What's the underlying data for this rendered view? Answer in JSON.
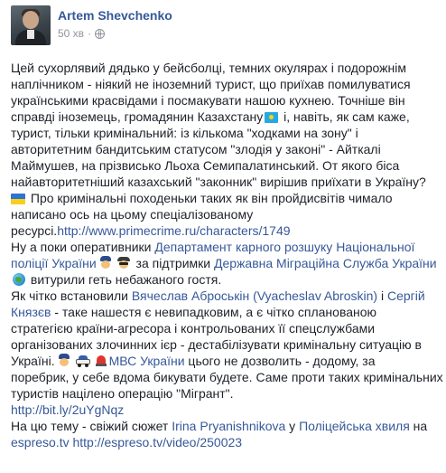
{
  "post": {
    "author": "Artem Shevchenko",
    "time": "50 хв",
    "globe_icon": "globe-icon",
    "lines": [
      {
        "text": "Цей сухорлявий дядько у бейсболці, темних окулярах і подорожнім"
      },
      {
        "text": "наплічником - ніякий не іноземний турист, що приїхав помилуватися"
      },
      {
        "text": "українськими красвідами і посмакувати нашою кухнею. Точніше він"
      },
      {
        "before": "справді іноземець, громадянин Казахстану",
        "emoji": "kazakhstan-flag-icon",
        "after": " і, навіть, як сам каже,"
      },
      {
        "text": "турист, тільки кримінальний: із кількома \"ходками на зону\" і"
      },
      {
        "text": "авторитетним бандитським статусом \"злодія у законі\" - Айткалі"
      },
      {
        "text": "Маймушев, на прізвисько Льоха Семипалатинський. От якого біса"
      },
      {
        "text": "найавторитетніший казахський \"законник\" вирішив приїхати в Україну?"
      },
      {
        "emoji": "ukraine-flag-icon",
        "after": " Про кримінальні походеньки таких як він пройдисвітів чимало"
      },
      {
        "text": "написано ось на цьому спеціалізованому"
      },
      {
        "before": "ресурсі.",
        "link": "http://www.primecrime.ru/characters/1749"
      }
    ],
    "p2": {
      "l1_before": "Ну а поки оперативники ",
      "l1_link": "Департамент карного розшуку Національної",
      "l2_link": "поліції України",
      "l2_mid": " за підтримки ",
      "l2_link2": "Державна Міграційна Служба України",
      "l3_after": " витурили геть небажаного гостя."
    },
    "p3": {
      "l1_before": "Як чітко встановили ",
      "l1_link": "Вячеслав Аброськін (Vyacheslav Abroskin)",
      "l1_mid": " і ",
      "l1_link2": "Сергій",
      "l2_link": "Князєв",
      "l2_after": " - таке нашестя є невипадковим, а є чітко спланованою",
      "l3": "стратегією країни-агресора і контрольованих її спецслужбами",
      "l4": "організованих злочинних ієр - дестабілізувати кримінальну ситуацію в",
      "l5_before": "Україні.",
      "l5_link": "МВС України",
      "l5_after": " цього не дозволить - додому, за",
      "l6": "поребрик, у себе вдома бикувати будете. Саме проти таких кримінальних",
      "l7": "туристів націлено операцію \"Мігрант\".",
      "l8_link": "http://bit.ly/2uYgNqz"
    },
    "p4": {
      "l1_before": "На цю тему - свіжий сюжет ",
      "l1_link": "Irina Pryanishnikova",
      "l1_mid": " у ",
      "l1_link2": "Поліцейська хвиля",
      "l1_after": " на",
      "l2_link": "espreso.tv",
      "l2_link2": "http://espreso.tv/video/250023"
    }
  }
}
